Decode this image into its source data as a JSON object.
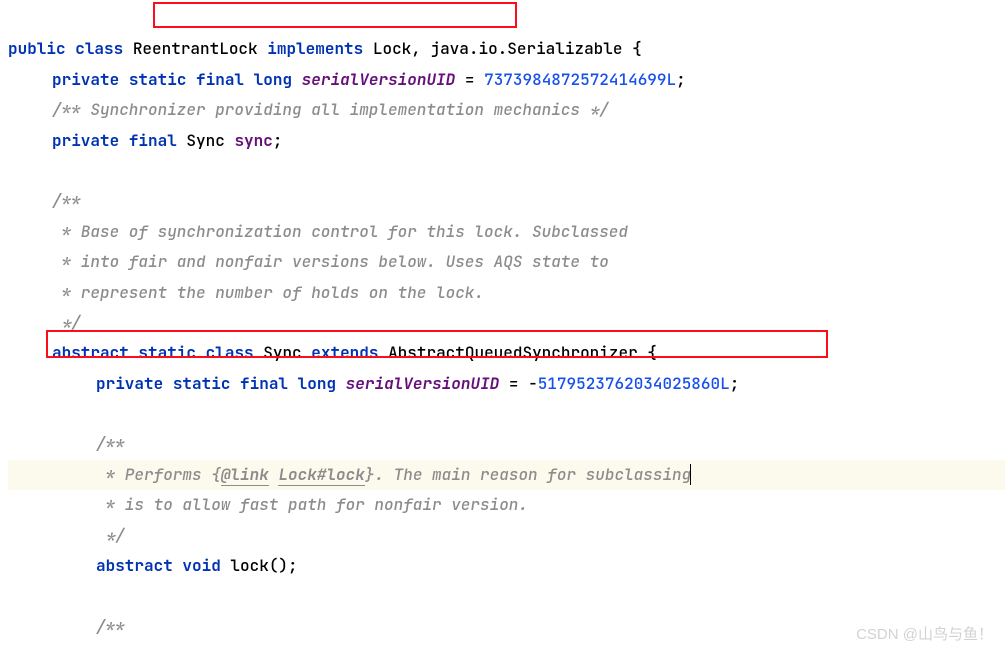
{
  "line1": {
    "kw1": "public",
    "kw2": "class",
    "cls": " ReentrantLock ",
    "kw3": "implements",
    "iface": " Lock, java.io.Serializable {"
  },
  "line2": {
    "kw1": "private",
    "kw2": "static",
    "kw3": "final",
    "kw4": "long",
    "field": "serialVersionUID",
    "eq": " = ",
    "num": "7373984872572414699L",
    "semi": ";"
  },
  "line3": "/** Synchronizer providing all implementation mechanics */",
  "line4": {
    "kw1": "private",
    "kw2": "final",
    "type": " Sync ",
    "field": "sync",
    "semi": ";"
  },
  "line6": "/**",
  "line7": " * Base of synchronization control for this lock. Subclassed",
  "line8": " * into fair and nonfair versions below. Uses AQS state to",
  "line9": " * represent the number of holds on the lock.",
  "line10": " */",
  "line11": {
    "kw1": "abstract",
    "kw2": "static",
    "kw3": "class",
    "cls": " Sync ",
    "kw4": "extends",
    "sup": " AbstractQueuedSynchronizer {"
  },
  "line12": {
    "kw1": "private",
    "kw2": "static",
    "kw3": "final",
    "kw4": "long",
    "field": "serialVersionUID",
    "eq": " = -",
    "num": "5179523762034025860L",
    "semi": ";"
  },
  "line14": "/**",
  "line15a": " * Performs {",
  "line15b": "@link",
  "line15c": " ",
  "line15d": "Lock#lock",
  "line15e": "}. The main reason for subclassing",
  "line16": " * is to allow fast path for nonfair version.",
  "line17": " */",
  "line18": {
    "kw1": "abstract",
    "kw2": "void",
    "method": " lock();"
  },
  "line20": "/**",
  "watermark": "CSDN @山鸟与鱼！"
}
